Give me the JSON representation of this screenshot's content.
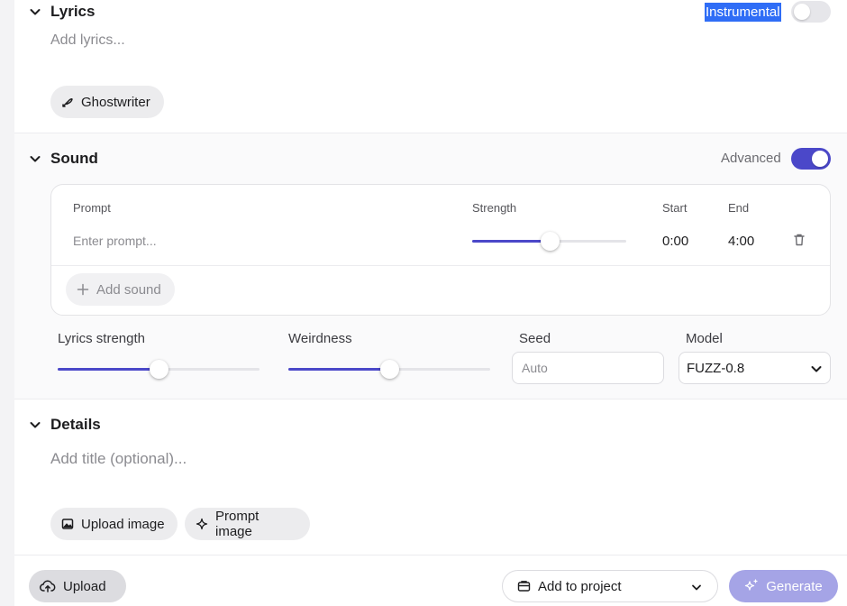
{
  "lyrics": {
    "title": "Lyrics",
    "instrumental_label": "Instrumental",
    "instrumental_on": false,
    "placeholder": "Add lyrics...",
    "ghostwriter_label": "Ghostwriter"
  },
  "sound": {
    "title": "Sound",
    "advanced_label": "Advanced",
    "advanced_on": true,
    "headers": {
      "prompt": "Prompt",
      "strength": "Strength",
      "start": "Start",
      "end": "End"
    },
    "row": {
      "prompt_placeholder": "Enter prompt...",
      "strength": 0.5,
      "start": "0:00",
      "end": "4:00"
    },
    "add_sound_label": "Add sound",
    "lyrics_strength_label": "Lyrics strength",
    "lyrics_strength": 0.5,
    "weirdness_label": "Weirdness",
    "weirdness": 0.5,
    "seed_label": "Seed",
    "seed_placeholder": "Auto",
    "model_label": "Model",
    "model_value": "FUZZ-0.8"
  },
  "details": {
    "title": "Details",
    "placeholder": "Add title (optional)...",
    "upload_image_label": "Upload image",
    "prompt_image_label": "Prompt image"
  },
  "footer": {
    "upload_label": "Upload",
    "add_to_project_label": "Add to project",
    "generate_label": "Generate"
  },
  "colors": {
    "accent": "#4b48c9",
    "generate_bg": "#a5a4e6",
    "selection": "#2f6df6"
  },
  "icons": [
    "chevron-down-icon",
    "pen-icon",
    "plus-icon",
    "trash-icon",
    "image-icon",
    "sparkle-icon",
    "cloud-upload-icon",
    "folder-icon",
    "stars-icon"
  ]
}
